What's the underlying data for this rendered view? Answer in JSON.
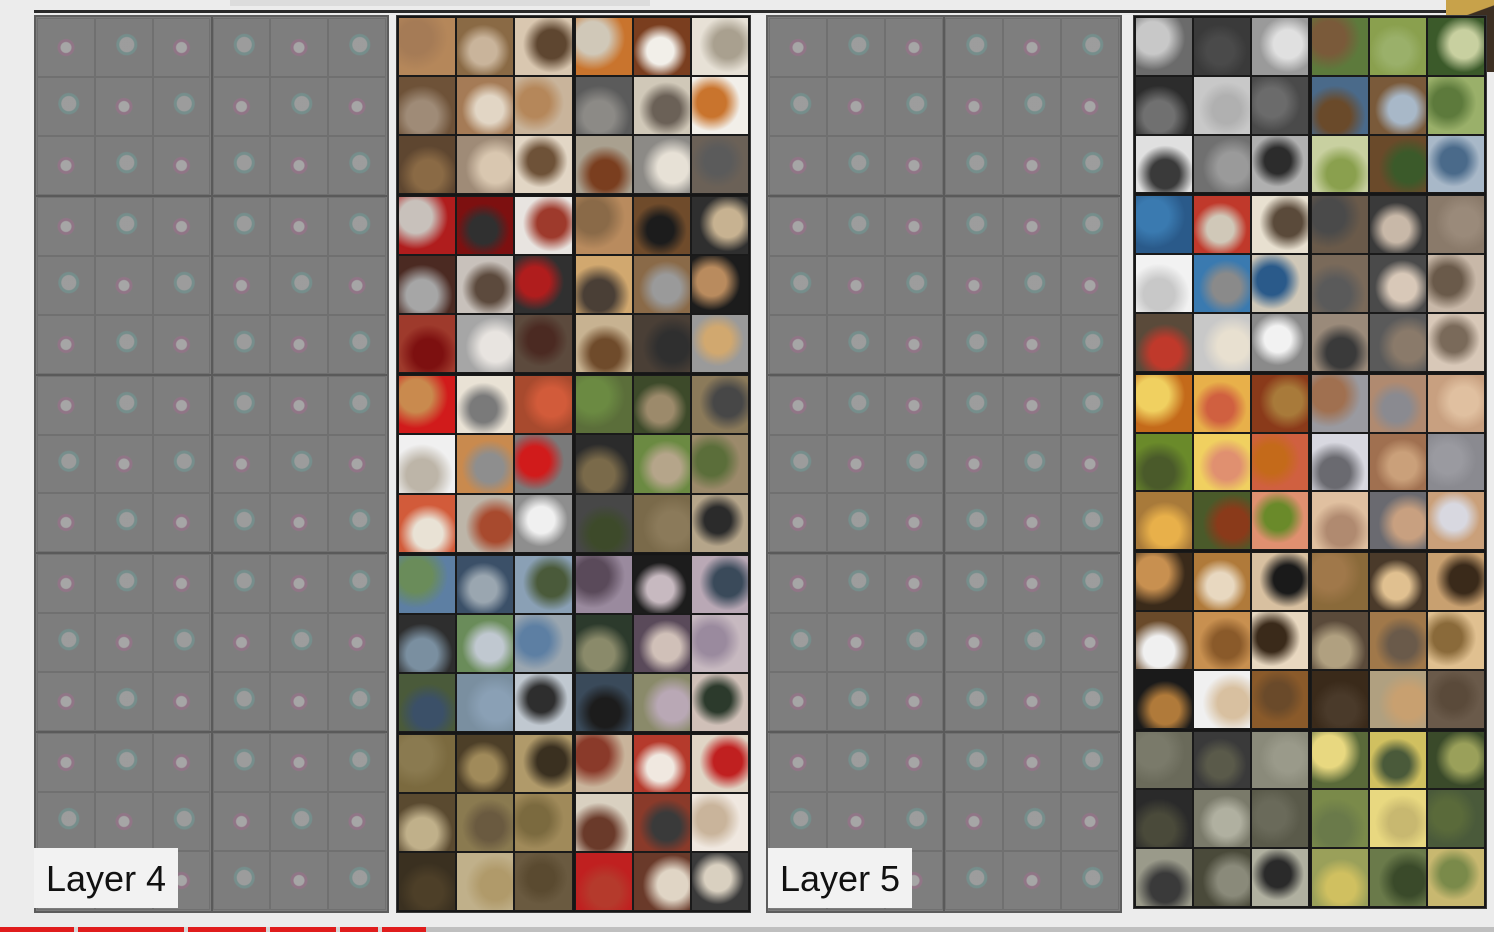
{
  "labels": {
    "layer4": "Layer 4",
    "layer5": "Layer 5"
  },
  "colors": {
    "accent": "#e01c1c",
    "panel_gray": "#7c7c7c"
  },
  "layer4": {
    "feature_blocks": 10,
    "photo_palettes": [
      [
        "#b5875a",
        "#8a6a45",
        "#d9c7b0",
        "#6e5238",
        "#a57b56",
        "#c9b49b",
        "#5e4630",
        "#9f8b77",
        "#e2d6c5"
      ],
      [
        "#c9742d",
        "#7a3e1f",
        "#e7e1d6",
        "#5b5b5b",
        "#d0c8b8",
        "#f2efe9",
        "#a9a08f",
        "#8c8a86",
        "#6b6157"
      ],
      [
        "#b01d1d",
        "#7d1010",
        "#e8e4e0",
        "#4b2a22",
        "#c8c1bb",
        "#303030",
        "#9e3a2c",
        "#a6a6a6",
        "#5c4a3d"
      ],
      [
        "#b98b5e",
        "#6f4b2b",
        "#2f2f2f",
        "#d1a86f",
        "#8a6a48",
        "#1c1c1c",
        "#c7b291",
        "#4a3f36",
        "#9a9a9a"
      ],
      [
        "#d11b1b",
        "#e9e2d5",
        "#a84a2e",
        "#f0f0f0",
        "#c98a4e",
        "#7a7a7a",
        "#d25b3a",
        "#bdb5a8",
        "#8e8e8e"
      ],
      [
        "#5b6e3a",
        "#3d4a2a",
        "#8b7a5a",
        "#2b2b2b",
        "#6b8a42",
        "#9c8a6b",
        "#474747",
        "#7a6a4a",
        "#b5a58a"
      ],
      [
        "#5d7fa3",
        "#3b5068",
        "#8aa0b5",
        "#2e2e2e",
        "#6a8c5a",
        "#9aa6b0",
        "#4a5a3a",
        "#7a8fa0",
        "#c0c8d0"
      ],
      [
        "#9a8a9e",
        "#1c1c1c",
        "#b9a8b5",
        "#2c3a2c",
        "#5a4a5a",
        "#c7b9c0",
        "#3a4a5a",
        "#8a8a6a",
        "#d0c0b8"
      ],
      [
        "#7b6a3f",
        "#4d3f28",
        "#b09a6a",
        "#5a4a30",
        "#8a7a50",
        "#a08a5a",
        "#3a3020",
        "#c0b08a",
        "#6a5a40"
      ],
      [
        "#c9b49b",
        "#b53a2c",
        "#e0d5c5",
        "#d9d0c0",
        "#8a3a2a",
        "#f0e8e0",
        "#c02020",
        "#6a3a2a",
        "#3a3a3a"
      ]
    ]
  },
  "layer5": {
    "feature_blocks": 10,
    "photo_palettes": [
      [
        "#6b6b6b",
        "#3a3a3a",
        "#9a9a9a",
        "#2c2c2c",
        "#c8c8c8",
        "#4a4a4a",
        "#e0e0e0",
        "#707070",
        "#b0b0b0"
      ],
      [
        "#5d7a3c",
        "#8aa04e",
        "#3b5a2a",
        "#4a6a8a",
        "#7a5a3a",
        "#9ab06a",
        "#c8d0a0",
        "#6a4a2a",
        "#a8b8c8"
      ],
      [
        "#2a5a8a",
        "#c0392b",
        "#e8e0d0",
        "#f2f2f2",
        "#3a7ab0",
        "#d0c8b8",
        "#5a4a3a",
        "#c8c8c8",
        "#8a8a8a"
      ],
      [
        "#6a5a4a",
        "#3a3a3a",
        "#8a7a6a",
        "#7a6a5a",
        "#4a4a4a",
        "#c8b8a8",
        "#9a8a7a",
        "#5a5a5a",
        "#d8c8b8"
      ],
      [
        "#c46a1a",
        "#e8b04a",
        "#8a3a1a",
        "#6a8a2a",
        "#f0d060",
        "#d06040",
        "#a87a3a",
        "#4a5a2a",
        "#e09070"
      ],
      [
        "#9a9aa0",
        "#b08a70",
        "#c8a080",
        "#d8d8e0",
        "#a07050",
        "#8a8a90",
        "#e0c0a0",
        "#6a6a70",
        "#caa07a"
      ],
      [
        "#3a2a1a",
        "#b07a3a",
        "#d8c0a0",
        "#6a4a2a",
        "#c89050",
        "#e8d8c0",
        "#1a1a1a",
        "#f0f0f0",
        "#8a5a2a"
      ],
      [
        "#8a6a3a",
        "#4a3a2a",
        "#c8a070",
        "#5a4a3a",
        "#a0784a",
        "#e0c090",
        "#3a2a1a",
        "#b0a080",
        "#6a5a4a"
      ],
      [
        "#6a6a5a",
        "#3a3a3a",
        "#8a8a7a",
        "#2a2a2a",
        "#7a7a6a",
        "#5a5a4a",
        "#9a9a8a",
        "#4a4a3a",
        "#b0b0a0"
      ],
      [
        "#5a6a3a",
        "#d0c060",
        "#3a4a2a",
        "#7a8a4a",
        "#e8d880",
        "#4a5a3a",
        "#9aa05a",
        "#6a7a4a",
        "#c8b870"
      ]
    ]
  }
}
